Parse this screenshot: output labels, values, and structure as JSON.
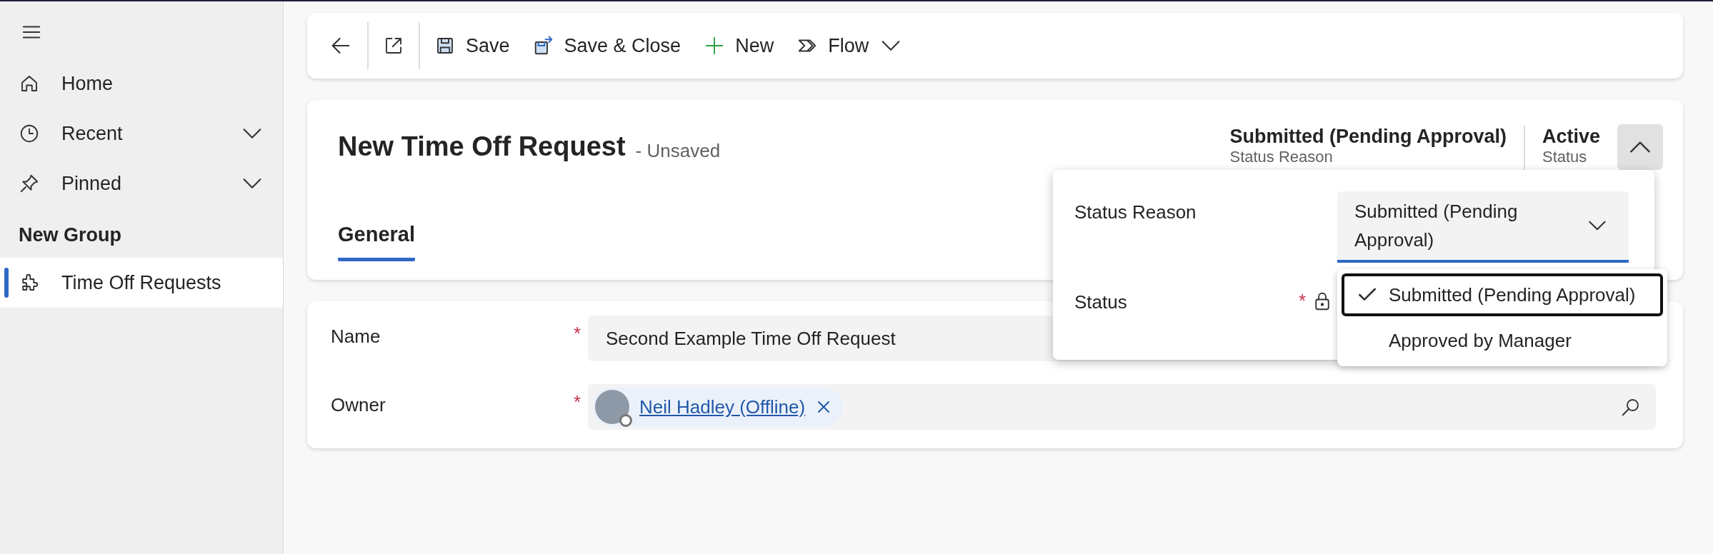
{
  "sidebar": {
    "items": [
      {
        "label": "Home",
        "selected": false
      },
      {
        "label": "Recent",
        "selected": false,
        "expanded": false
      },
      {
        "label": "Pinned",
        "selected": false,
        "expanded": false
      }
    ],
    "group": {
      "title": "New Group",
      "items": [
        {
          "label": "Time Off Requests",
          "selected": true
        }
      ]
    }
  },
  "toolbar": {
    "buttons": [
      {
        "label": "Save"
      },
      {
        "label": "Save & Close"
      },
      {
        "label": "New"
      },
      {
        "label": "Flow",
        "has_menu": true
      }
    ]
  },
  "header": {
    "title": "New Time Off Request",
    "subtitle": "- Unsaved",
    "expanded": true,
    "fields": [
      {
        "value": "Submitted (Pending Approval)",
        "label": "Status Reason"
      },
      {
        "value": "Active",
        "label": "Status"
      }
    ],
    "tabs": [
      {
        "label": "General",
        "selected": true
      }
    ]
  },
  "form": {
    "fields": [
      {
        "kind": "text",
        "label": "Name",
        "required_mark": "*",
        "value": "Second Example Time Off Request"
      },
      {
        "kind": "lookup",
        "label": "Owner",
        "required_mark": "*",
        "value": "Neil Hadley (Offline)"
      }
    ]
  },
  "flyout": {
    "fields": [
      {
        "kind": "select",
        "label": "Status Reason",
        "value": "Submitted (Pending Approval)"
      },
      {
        "kind": "locked",
        "label": "Status",
        "required_mark": "*"
      }
    ],
    "options": [
      {
        "label": "Submitted (Pending Approval)",
        "selected": true
      },
      {
        "label": "Approved by Manager",
        "selected": false
      }
    ]
  }
}
